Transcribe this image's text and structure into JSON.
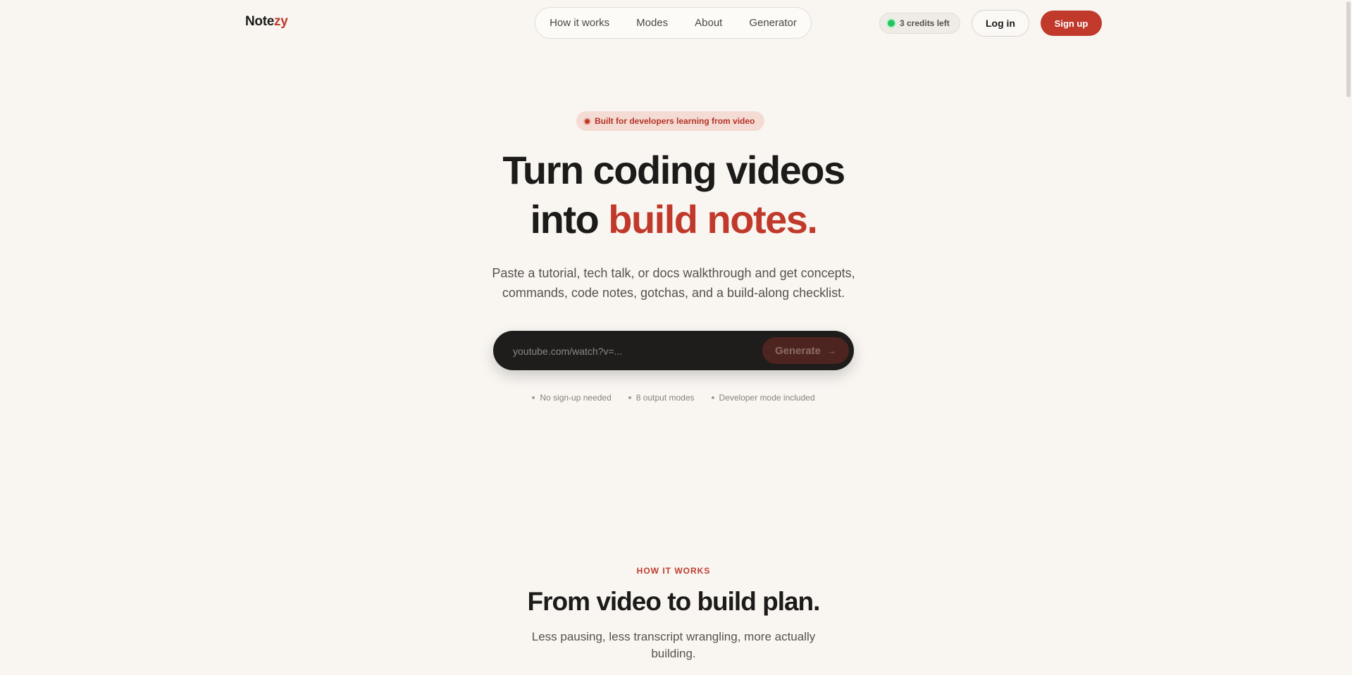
{
  "nav": {
    "logo_main": "Note",
    "logo_accent": "zy",
    "links": [
      "How it works",
      "Modes",
      "About",
      "Generator"
    ],
    "credits": "3 credits left",
    "login": "Log in",
    "signup": "Sign up"
  },
  "hero": {
    "badge": "Built for developers learning from video",
    "title_line1": "Turn coding videos",
    "title_line2_prefix": "into ",
    "title_line2_accent": "build notes.",
    "subtitle": "Paste a tutorial, tech talk, or docs walkthrough and get concepts, commands, code notes, gotchas, and a build-along checklist.",
    "input_placeholder": "youtube.com/watch?v=...",
    "generate_label": "Generate",
    "features": [
      "No sign-up needed",
      "8 output modes",
      "Developer mode included"
    ]
  },
  "how_it_works": {
    "label": "HOW IT WORKS",
    "title": "From video to build plan.",
    "subtitle": "Less pausing, less transcript wrangling, more actually building."
  },
  "colors": {
    "accent": "#c0392b",
    "background": "#f9f6f2",
    "dark": "#1f1d1c",
    "status_green": "#22c55e"
  },
  "icons": {
    "status": "green-dot-icon",
    "badge": "red-dot-icon",
    "generate": "arrow-right-icon",
    "bullet": "bullet-dot-icon"
  }
}
